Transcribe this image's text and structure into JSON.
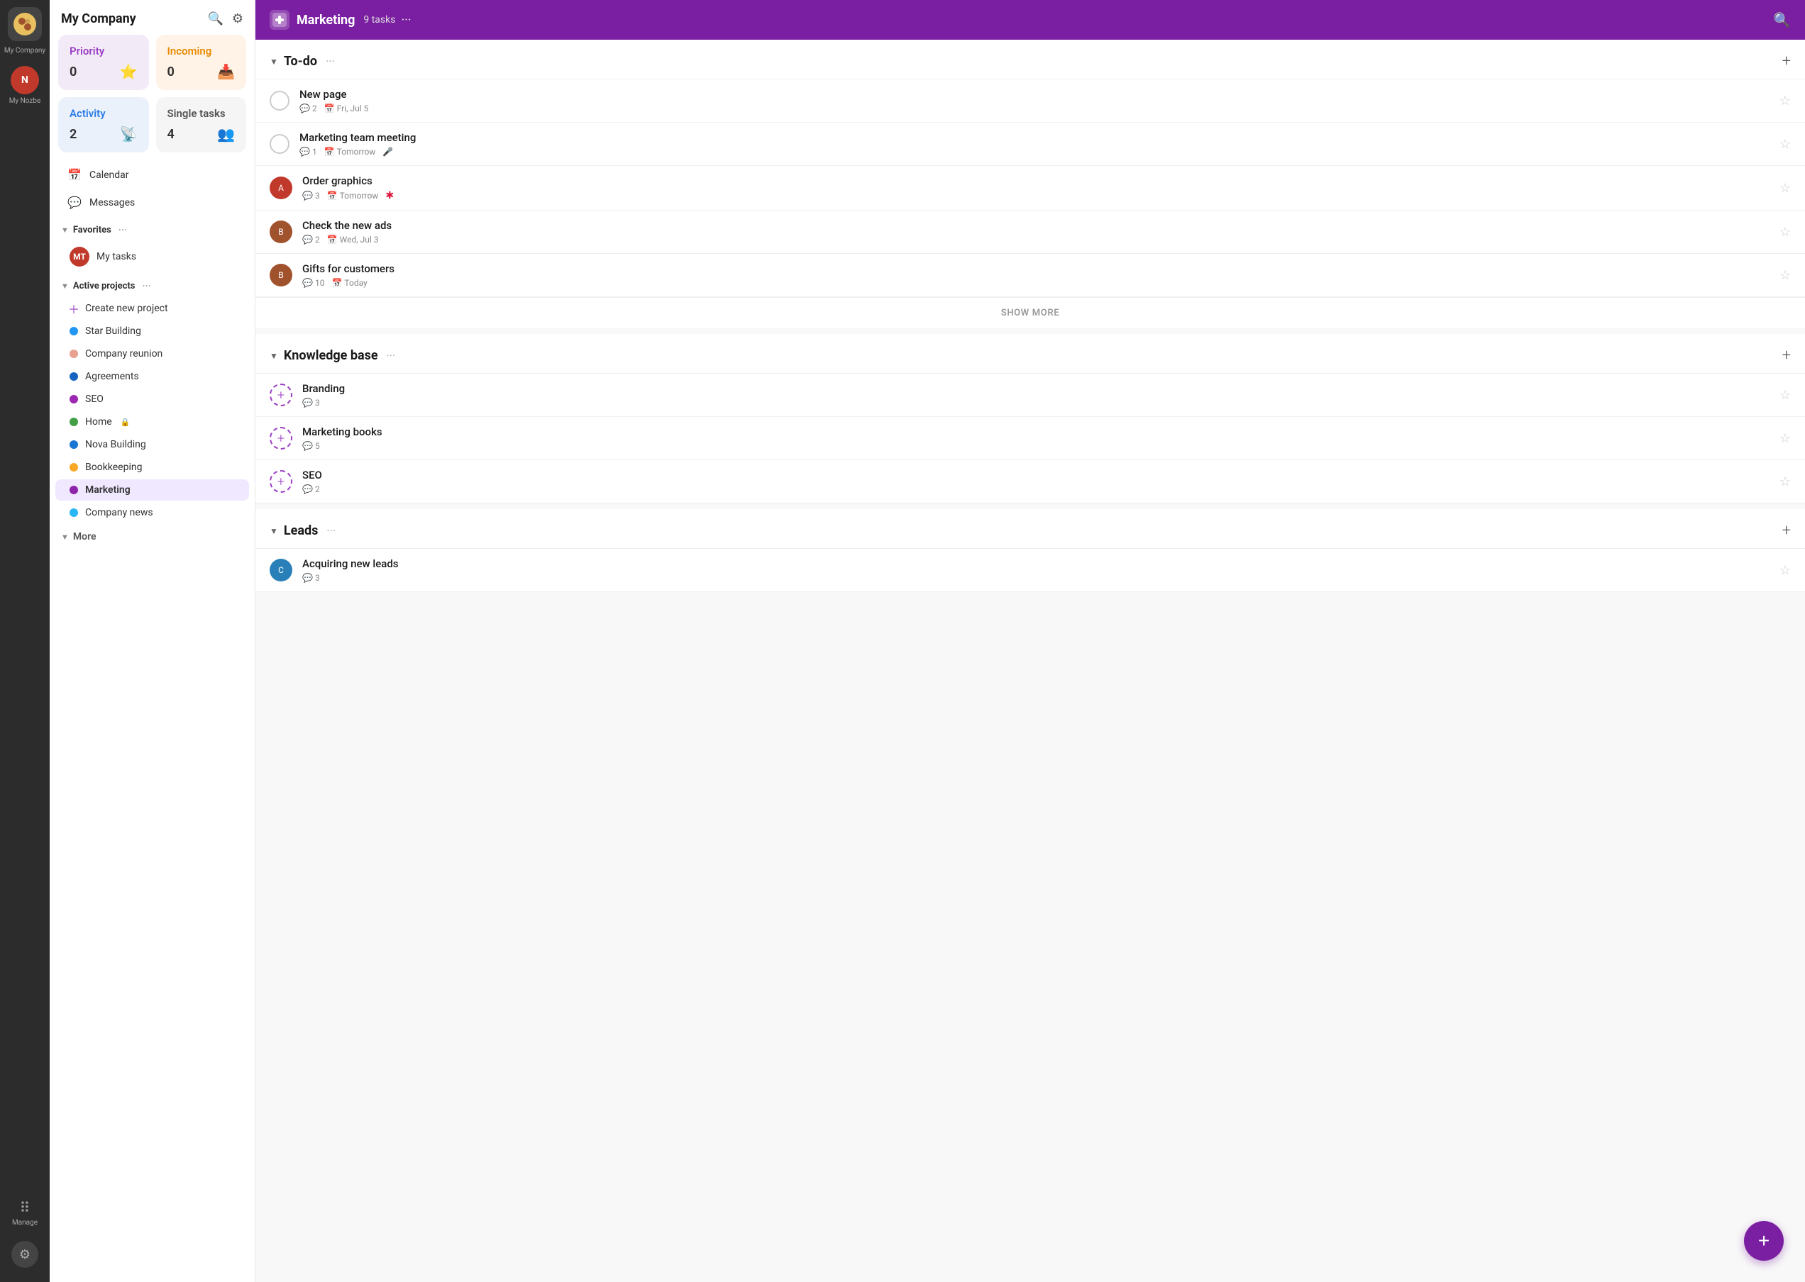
{
  "app": {
    "company": "My Company",
    "user": "My Nozbe",
    "manage": "Manage"
  },
  "stats": {
    "priority": {
      "label": "Priority",
      "count": "0",
      "icon": "⭐"
    },
    "incoming": {
      "label": "Incoming",
      "count": "0",
      "icon": "📥"
    },
    "activity": {
      "label": "Activity",
      "count": "2",
      "icon": "📡"
    },
    "single": {
      "label": "Single tasks",
      "count": "4",
      "icon": "👥"
    }
  },
  "nav": {
    "calendar": "Calendar",
    "messages": "Messages"
  },
  "favorites": {
    "title": "Favorites",
    "items": [
      {
        "label": "My tasks"
      }
    ]
  },
  "activeProjects": {
    "title": "Active projects",
    "create": "Create new project",
    "items": [
      {
        "label": "Star Building",
        "color": "#2196f3"
      },
      {
        "label": "Company reunion",
        "color": "#e8a090"
      },
      {
        "label": "Agreements",
        "color": "#1565c0"
      },
      {
        "label": "SEO",
        "color": "#9c27b0"
      },
      {
        "label": "Home",
        "color": "#43a047",
        "locked": true
      },
      {
        "label": "Nova Building",
        "color": "#1976d2"
      },
      {
        "label": "Bookkeeping",
        "color": "#f9a825"
      },
      {
        "label": "Marketing",
        "color": "#8e24aa",
        "active": true
      },
      {
        "label": "Company news",
        "color": "#29b6f6"
      }
    ]
  },
  "more": {
    "label": "More"
  },
  "topbar": {
    "title": "Marketing",
    "badge": "9 tasks",
    "more": "···"
  },
  "sections": [
    {
      "id": "todo",
      "title": "To-do",
      "tasks": [
        {
          "id": 1,
          "name": "New page",
          "comments": "2",
          "date": "Fri, Jul 5",
          "avatarType": "checkbox"
        },
        {
          "id": 2,
          "name": "Marketing team meeting",
          "comments": "1",
          "date": "Tomorrow",
          "dateIcon": "📅",
          "avatarType": "checkbox",
          "extraIcon": "🎤"
        },
        {
          "id": 3,
          "name": "Order graphics",
          "comments": "3",
          "date": "Tomorrow",
          "dateIcon": "📅",
          "avatarType": "avatar",
          "avatarColor": "av-red",
          "avatarInitial": "A",
          "extraIcon": "🔴"
        },
        {
          "id": 4,
          "name": "Check the new ads",
          "comments": "2",
          "date": "Wed, Jul 3",
          "dateIcon": "📅",
          "avatarType": "avatar",
          "avatarColor": "av-brown",
          "avatarInitial": "B"
        },
        {
          "id": 5,
          "name": "Gifts for customers",
          "comments": "10",
          "date": "Today",
          "dateIcon": "📅",
          "avatarType": "avatar",
          "avatarColor": "av-brown",
          "avatarInitial": "B"
        }
      ],
      "showMore": "SHOW MORE"
    },
    {
      "id": "knowledge",
      "title": "Knowledge base",
      "tasks": [
        {
          "id": 6,
          "name": "Branding",
          "comments": "3",
          "avatarType": "plus"
        },
        {
          "id": 7,
          "name": "Marketing books",
          "comments": "5",
          "avatarType": "plus"
        },
        {
          "id": 8,
          "name": "SEO",
          "comments": "2",
          "avatarType": "plus"
        }
      ]
    },
    {
      "id": "leads",
      "title": "Leads",
      "tasks": [
        {
          "id": 9,
          "name": "Acquiring new leads",
          "comments": "3",
          "avatarType": "avatar",
          "avatarColor": "av-blue",
          "avatarInitial": "C"
        }
      ]
    }
  ]
}
